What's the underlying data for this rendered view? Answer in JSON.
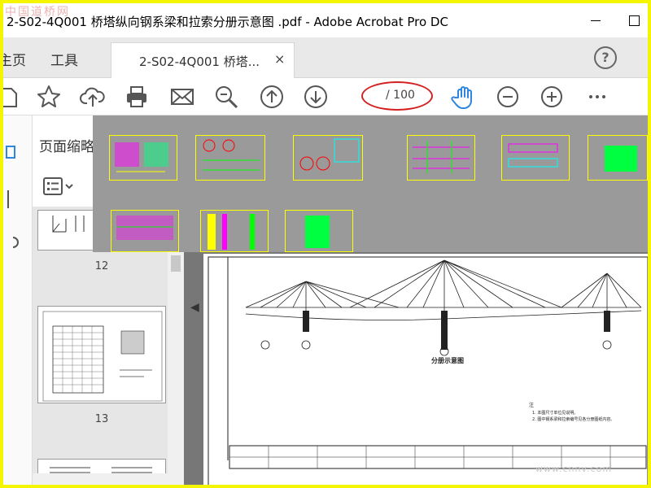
{
  "window": {
    "title": "2-S02-4Q001 桥塔纵向钢系梁和拉索分册示意图 .pdf - Adobe Acrobat Pro DC",
    "watermark": "中国道桥网"
  },
  "menu": {
    "home_label": "主页",
    "tools_label": "工具"
  },
  "tab": {
    "label": "2-S02-4Q001 桥塔...",
    "close": "×"
  },
  "help": {
    "glyph": "?"
  },
  "toolbar": {
    "page_display": "/ 100",
    "icons": [
      "save-icon",
      "star-icon",
      "upload-cloud-icon",
      "print-icon",
      "mail-icon",
      "zoom-search-icon",
      "page-up-icon",
      "page-down-icon",
      "hand-tool-icon",
      "zoom-out-icon",
      "zoom-in-icon",
      "more-icon"
    ],
    "hand_color": "#2e86de"
  },
  "left_panel": {
    "title": "页面缩略",
    "thumbnails": [
      {
        "page": "12"
      },
      {
        "page": "13"
      }
    ]
  },
  "drawing": {
    "caption": "分册示意图",
    "notes_title": "注",
    "notes": [
      "1. 本图尺寸单位见说明。",
      "2. 图中钢系梁和拉索编号见各分册图纸内容。"
    ]
  },
  "footer_watermark": "www.cnnv.com",
  "colors": {
    "highlight": "#f5f500",
    "annotation": "#d32020"
  }
}
